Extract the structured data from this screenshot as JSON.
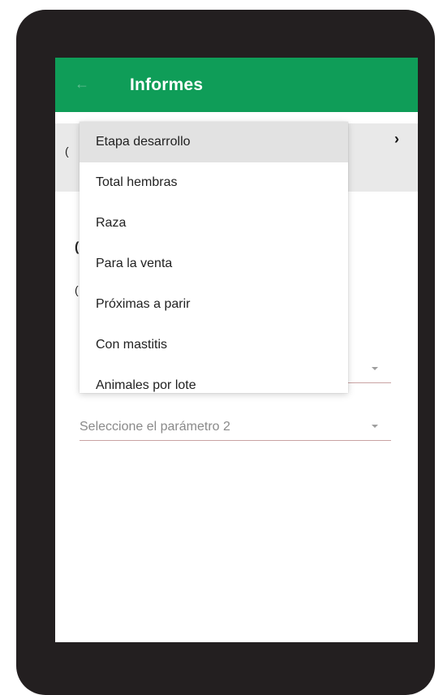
{
  "appbar": {
    "title": "Informes",
    "back_icon": "arrow-left-icon",
    "color": "#0f9d58"
  },
  "menu": {
    "items": [
      {
        "label": "Etapa desarrollo",
        "selected": true
      },
      {
        "label": "Total hembras",
        "selected": false
      },
      {
        "label": "Raza",
        "selected": false
      },
      {
        "label": "Para la venta",
        "selected": false
      },
      {
        "label": "Próximas a parir",
        "selected": false
      },
      {
        "label": "Con mastitis",
        "selected": false
      },
      {
        "label": "Animales por lote",
        "selected": false
      }
    ]
  },
  "form": {
    "param2_placeholder": "Seleccione el parámetro 2"
  },
  "underlying": {
    "chevron_icon": "chevron-right-icon",
    "chevron": "›"
  }
}
